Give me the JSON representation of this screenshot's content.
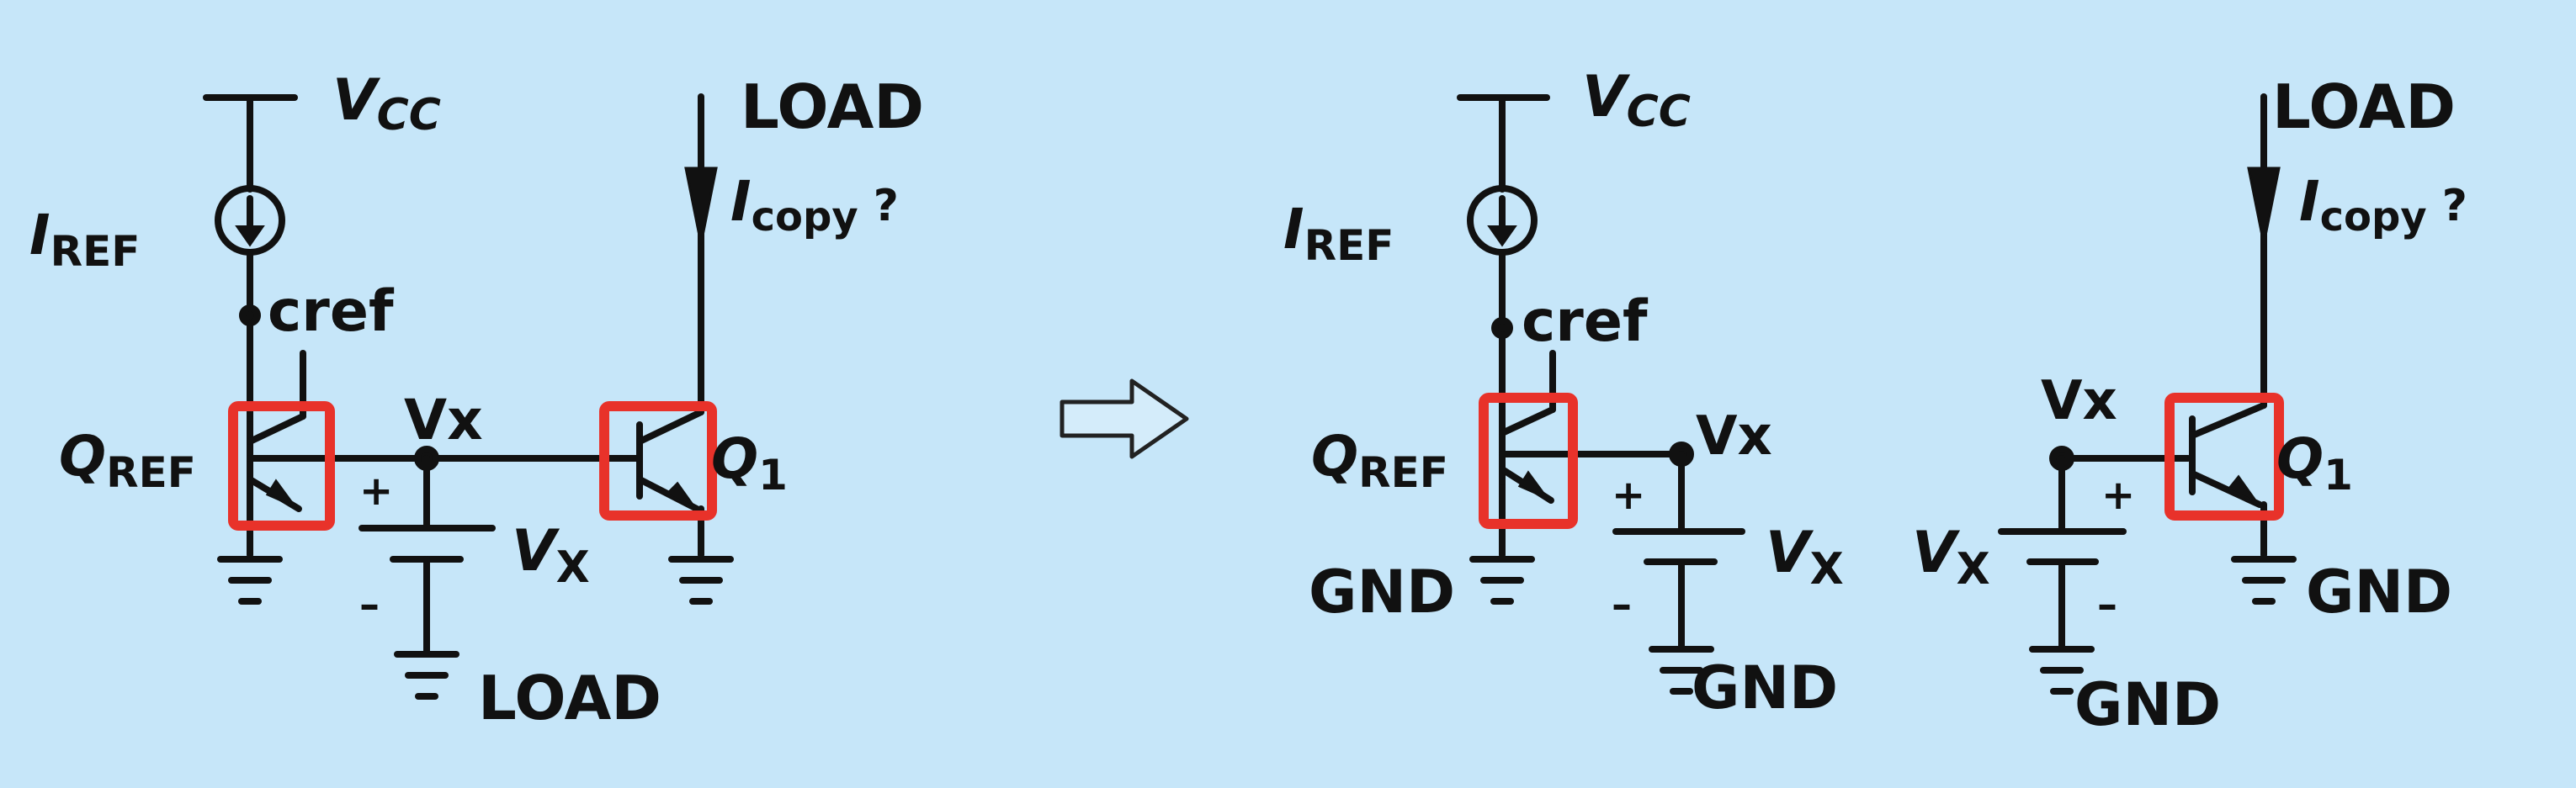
{
  "background_color": "#c6e6f9",
  "highlight_color": "#e8322a",
  "wire_color": "#111111",
  "left_circuit": {
    "vcc": {
      "main": "V",
      "sub": "CC"
    },
    "iref": {
      "main": "I",
      "sub": "REF"
    },
    "cref": "cref",
    "qref": {
      "main": "Q",
      "sub": "REF"
    },
    "vx_node": "Vx",
    "vx_source": {
      "main": "V",
      "sub": "X"
    },
    "plus": "+",
    "minus": "–",
    "load_bottom": "LOAD",
    "load_top": "LOAD",
    "icopy": {
      "main": "I",
      "sub": "copy",
      "suffix": " ?"
    },
    "q1": {
      "main": "Q",
      "sub": "1"
    }
  },
  "arrow": {
    "icon": "hollow-right-arrow-icon"
  },
  "right_circuit": {
    "vcc": {
      "main": "V",
      "sub": "CC"
    },
    "iref": {
      "main": "I",
      "sub": "REF"
    },
    "cref": "cref",
    "qref": {
      "main": "Q",
      "sub": "REF"
    },
    "vx_node_a": "Vx",
    "vx_source_a": {
      "main": "V",
      "sub": "X"
    },
    "plus_a": "+",
    "minus_a": "–",
    "gnd_qref": "GND",
    "gnd_source_a": "GND",
    "load_top": "LOAD",
    "icopy": {
      "main": "I",
      "sub": "copy",
      "suffix": " ?"
    },
    "vx_node_b": "Vx",
    "vx_source_b": {
      "main": "V",
      "sub": "X"
    },
    "plus_b": "+",
    "minus_b": "–",
    "q1": {
      "main": "Q",
      "sub": "1"
    },
    "gnd_q1": "GND",
    "gnd_source_b": "GND"
  }
}
